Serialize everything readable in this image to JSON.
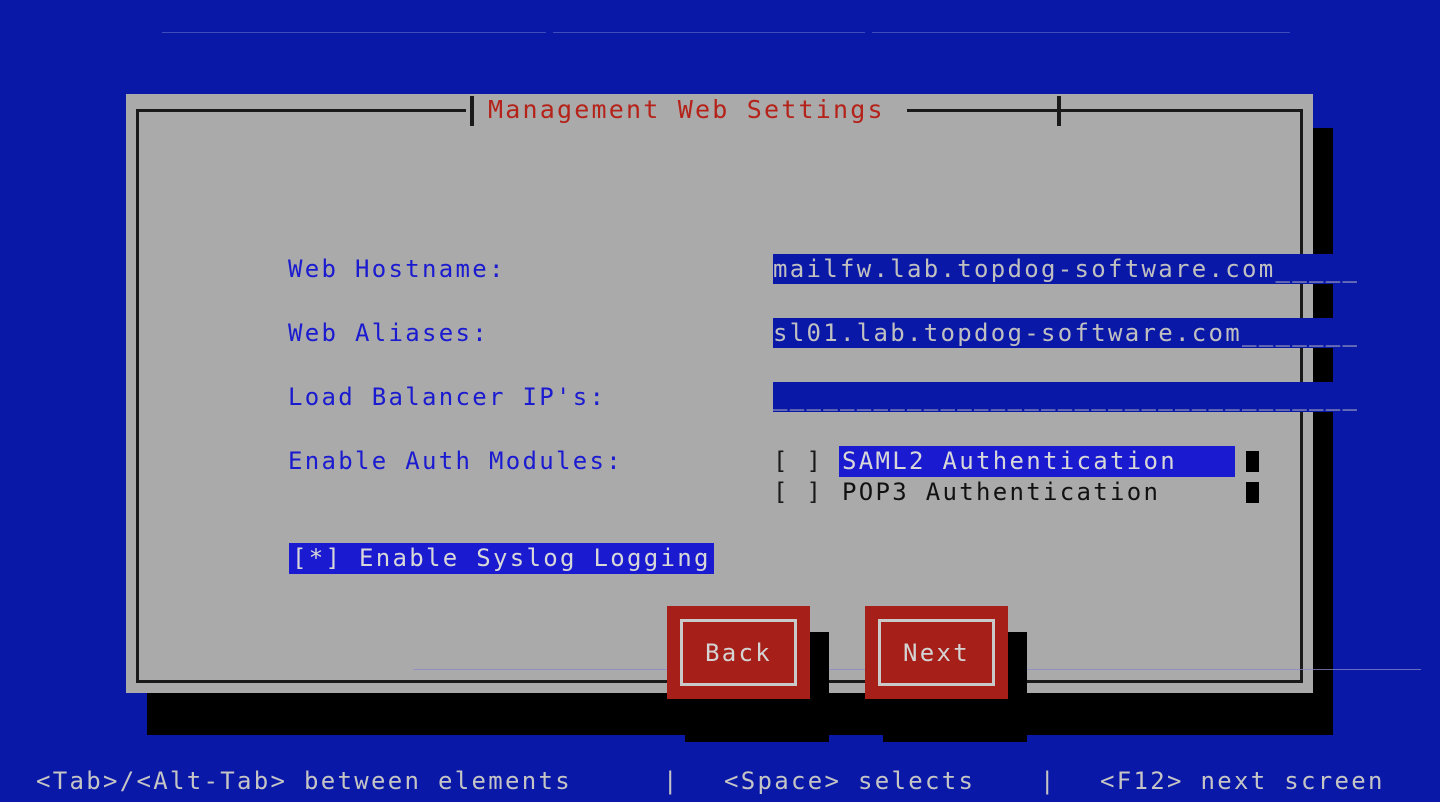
{
  "screen": {
    "background_color": "#0a18a8",
    "panel_color": "#aaaaaa",
    "accent_red": "#b52219",
    "button_red": "#a62019",
    "highlight_blue": "#1a1ad0"
  },
  "dialog": {
    "title": "Management Web Settings",
    "fields": [
      {
        "label": "Web Hostname:",
        "value": "mailfw.lab.topdog-software.com_____",
        "placeholder": "__________________________________"
      },
      {
        "label": "Web Aliases:",
        "value": "sl01.lab.topdog-software.com_______",
        "placeholder": "__________________________________"
      },
      {
        "label": "Load Balancer IP's:",
        "value": "___________________________________",
        "placeholder": "___________________________________"
      }
    ],
    "auth_modules": {
      "label": "Enable Auth Modules:",
      "items": [
        {
          "checkbox": "[ ]",
          "name": "SAML2 Authentication",
          "selected": true,
          "checked": false
        },
        {
          "checkbox": "[ ]",
          "name": "POP3 Authentication",
          "selected": false,
          "checked": false
        }
      ]
    },
    "syslog": {
      "text": "[*] Enable Syslog Logging",
      "checked": true,
      "selected": true
    },
    "buttons": [
      {
        "label": "Back"
      },
      {
        "label": "Next"
      }
    ]
  },
  "statusbar": {
    "segment_1": "<Tab>/<Alt-Tab> between elements",
    "separator_1": "|",
    "segment_2": "<Space> selects",
    "separator_2": "|",
    "segment_3": "<F12> next screen"
  }
}
